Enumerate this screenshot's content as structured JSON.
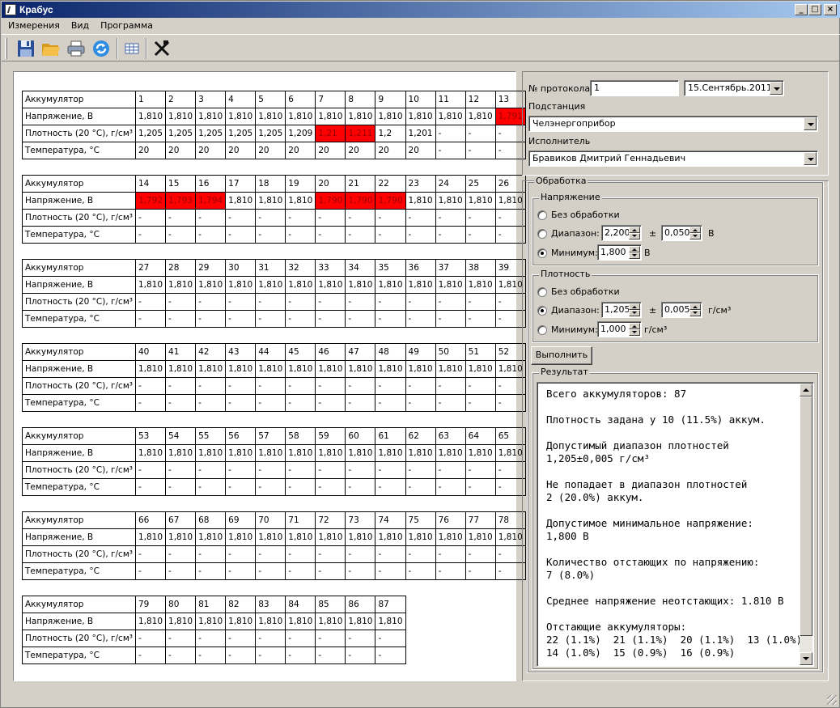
{
  "window": {
    "title": "Крабус"
  },
  "menu": [
    "Измерения",
    "Вид",
    "Программа"
  ],
  "toolbar": [
    {
      "icon": "save-icon"
    },
    {
      "icon": "open-folder-icon"
    },
    {
      "icon": "print-icon"
    },
    {
      "icon": "refresh-icon"
    },
    {
      "icon": "table-icon"
    },
    {
      "icon": "tools-icon"
    }
  ],
  "colors": {
    "highlight": "#ff0000"
  },
  "table": {
    "row_labels": [
      "Аккумулятор",
      "Напряжение, В",
      "Плотность (20 °C), г/см³",
      "Температура, °C"
    ],
    "blocks": [
      {
        "ids": [
          "1",
          "2",
          "3",
          "4",
          "5",
          "6",
          "7",
          "8",
          "9",
          "10",
          "11",
          "12",
          "13"
        ],
        "voltage": [
          "1,810",
          "1,810",
          "1,810",
          "1,810",
          "1,810",
          "1,810",
          "1,810",
          "1,810",
          "1,810",
          "1,810",
          "1,810",
          "1,810",
          "1,791"
        ],
        "density": [
          "1,205",
          "1,205",
          "1,205",
          "1,205",
          "1,205",
          "1,209",
          "1,21",
          "1,211",
          "1,2",
          "1,201",
          "-",
          "-",
          "-"
        ],
        "temperature": [
          "20",
          "20",
          "20",
          "20",
          "20",
          "20",
          "20",
          "20",
          "20",
          "20",
          "-",
          "-",
          "-"
        ],
        "voltage_flags": [
          0,
          0,
          0,
          0,
          0,
          0,
          0,
          0,
          0,
          0,
          0,
          0,
          1
        ],
        "density_flags": [
          0,
          0,
          0,
          0,
          0,
          0,
          1,
          1,
          0,
          0,
          0,
          0,
          0
        ]
      },
      {
        "ids": [
          "14",
          "15",
          "16",
          "17",
          "18",
          "19",
          "20",
          "21",
          "22",
          "23",
          "24",
          "25",
          "26"
        ],
        "voltage": [
          "1,792",
          "1,793",
          "1,794",
          "1,810",
          "1,810",
          "1,810",
          "1,790",
          "1,790",
          "1,790",
          "1,810",
          "1,810",
          "1,810",
          "1,810"
        ],
        "density": [
          "-",
          "-",
          "-",
          "-",
          "-",
          "-",
          "-",
          "-",
          "-",
          "-",
          "-",
          "-",
          "-"
        ],
        "temperature": [
          "-",
          "-",
          "-",
          "-",
          "-",
          "-",
          "-",
          "-",
          "-",
          "-",
          "-",
          "-",
          "-"
        ],
        "voltage_flags": [
          1,
          1,
          1,
          0,
          0,
          0,
          1,
          1,
          1,
          0,
          0,
          0,
          0
        ],
        "density_flags": [
          0,
          0,
          0,
          0,
          0,
          0,
          0,
          0,
          0,
          0,
          0,
          0,
          0
        ]
      },
      {
        "ids": [
          "27",
          "28",
          "29",
          "30",
          "31",
          "32",
          "33",
          "34",
          "35",
          "36",
          "37",
          "38",
          "39"
        ],
        "voltage": [
          "1,810",
          "1,810",
          "1,810",
          "1,810",
          "1,810",
          "1,810",
          "1,810",
          "1,810",
          "1,810",
          "1,810",
          "1,810",
          "1,810",
          "1,810"
        ],
        "density": [
          "-",
          "-",
          "-",
          "-",
          "-",
          "-",
          "-",
          "-",
          "-",
          "-",
          "-",
          "-",
          "-"
        ],
        "temperature": [
          "-",
          "-",
          "-",
          "-",
          "-",
          "-",
          "-",
          "-",
          "-",
          "-",
          "-",
          "-",
          "-"
        ],
        "voltage_flags": [
          0,
          0,
          0,
          0,
          0,
          0,
          0,
          0,
          0,
          0,
          0,
          0,
          0
        ],
        "density_flags": [
          0,
          0,
          0,
          0,
          0,
          0,
          0,
          0,
          0,
          0,
          0,
          0,
          0
        ]
      },
      {
        "ids": [
          "40",
          "41",
          "42",
          "43",
          "44",
          "45",
          "46",
          "47",
          "48",
          "49",
          "50",
          "51",
          "52"
        ],
        "voltage": [
          "1,810",
          "1,810",
          "1,810",
          "1,810",
          "1,810",
          "1,810",
          "1,810",
          "1,810",
          "1,810",
          "1,810",
          "1,810",
          "1,810",
          "1,810"
        ],
        "density": [
          "-",
          "-",
          "-",
          "-",
          "-",
          "-",
          "-",
          "-",
          "-",
          "-",
          "-",
          "-",
          "-"
        ],
        "temperature": [
          "-",
          "-",
          "-",
          "-",
          "-",
          "-",
          "-",
          "-",
          "-",
          "-",
          "-",
          "-",
          "-"
        ],
        "voltage_flags": [
          0,
          0,
          0,
          0,
          0,
          0,
          0,
          0,
          0,
          0,
          0,
          0,
          0
        ],
        "density_flags": [
          0,
          0,
          0,
          0,
          0,
          0,
          0,
          0,
          0,
          0,
          0,
          0,
          0
        ]
      },
      {
        "ids": [
          "53",
          "54",
          "55",
          "56",
          "57",
          "58",
          "59",
          "60",
          "61",
          "62",
          "63",
          "64",
          "65"
        ],
        "voltage": [
          "1,810",
          "1,810",
          "1,810",
          "1,810",
          "1,810",
          "1,810",
          "1,810",
          "1,810",
          "1,810",
          "1,810",
          "1,810",
          "1,810",
          "1,810"
        ],
        "density": [
          "-",
          "-",
          "-",
          "-",
          "-",
          "-",
          "-",
          "-",
          "-",
          "-",
          "-",
          "-",
          "-"
        ],
        "temperature": [
          "-",
          "-",
          "-",
          "-",
          "-",
          "-",
          "-",
          "-",
          "-",
          "-",
          "-",
          "-",
          "-"
        ],
        "voltage_flags": [
          0,
          0,
          0,
          0,
          0,
          0,
          0,
          0,
          0,
          0,
          0,
          0,
          0
        ],
        "density_flags": [
          0,
          0,
          0,
          0,
          0,
          0,
          0,
          0,
          0,
          0,
          0,
          0,
          0
        ]
      },
      {
        "ids": [
          "66",
          "67",
          "68",
          "69",
          "70",
          "71",
          "72",
          "73",
          "74",
          "75",
          "76",
          "77",
          "78"
        ],
        "voltage": [
          "1,810",
          "1,810",
          "1,810",
          "1,810",
          "1,810",
          "1,810",
          "1,810",
          "1,810",
          "1,810",
          "1,810",
          "1,810",
          "1,810",
          "1,810"
        ],
        "density": [
          "-",
          "-",
          "-",
          "-",
          "-",
          "-",
          "-",
          "-",
          "-",
          "-",
          "-",
          "-",
          "-"
        ],
        "temperature": [
          "-",
          "-",
          "-",
          "-",
          "-",
          "-",
          "-",
          "-",
          "-",
          "-",
          "-",
          "-",
          "-"
        ],
        "voltage_flags": [
          0,
          0,
          0,
          0,
          0,
          0,
          0,
          0,
          0,
          0,
          0,
          0,
          0
        ],
        "density_flags": [
          0,
          0,
          0,
          0,
          0,
          0,
          0,
          0,
          0,
          0,
          0,
          0,
          0
        ]
      },
      {
        "ids": [
          "79",
          "80",
          "81",
          "82",
          "83",
          "84",
          "85",
          "86",
          "87"
        ],
        "voltage": [
          "1,810",
          "1,810",
          "1,810",
          "1,810",
          "1,810",
          "1,810",
          "1,810",
          "1,810",
          "1,810"
        ],
        "density": [
          "-",
          "-",
          "-",
          "-",
          "-",
          "-",
          "-",
          "-",
          "-"
        ],
        "temperature": [
          "-",
          "-",
          "-",
          "-",
          "-",
          "-",
          "-",
          "-",
          "-"
        ],
        "voltage_flags": [
          0,
          0,
          0,
          0,
          0,
          0,
          0,
          0,
          0
        ],
        "density_flags": [
          0,
          0,
          0,
          0,
          0,
          0,
          0,
          0,
          0
        ]
      }
    ]
  },
  "protocol": {
    "number_label": "№ протокола",
    "number_value": "1",
    "date_value": "15.Сентябрь.2011",
    "substation_label": "Подстанция",
    "substation_value": "Челэнергоприбор",
    "executor_label": "Исполнитель",
    "executor_value": "Бравиков Дмитрий Геннадьевич"
  },
  "processing": {
    "title": "Обработка",
    "voltage": {
      "title": "Напряжение",
      "opt_none": "Без обработки",
      "opt_range": "Диапазон:",
      "opt_min": "Минимум:",
      "range_value": "2,200",
      "pm": "±",
      "range_tol": "0,050",
      "unit": "В",
      "min_value": "1,800",
      "selected": "min"
    },
    "density": {
      "title": "Плотность",
      "opt_none": "Без обработки",
      "opt_range": "Диапазон:",
      "opt_min": "Минимум:",
      "range_value": "1,205",
      "pm": "±",
      "range_tol": "0,005",
      "unit": "г/см³",
      "min_value": "1,000",
      "selected": "range"
    },
    "run_button": "Выполнить"
  },
  "result": {
    "title": "Результат",
    "text": "Всего аккумуляторов: 87\n\nПлотность задана у 10 (11.5%) аккум.\n\nДопустимый диапазон плотностей\n1,205±0,005 г/см³\n\nНе попадает в диапазон плотностей\n2 (20.0%) аккум.\n\nДопустимое минимальное напряжение:\n1,800 В\n\nКоличество отстающих по напряжению:\n7 (8.0%)\n\nСреднее напряжение неотстающих: 1.810 В\n\nОтстающие аккумуляторы:\n22 (1.1%)  21 (1.1%)  20 (1.1%)  13 (1.0%)\n14 (1.0%)  15 (0.9%)  16 (0.9%)"
  }
}
